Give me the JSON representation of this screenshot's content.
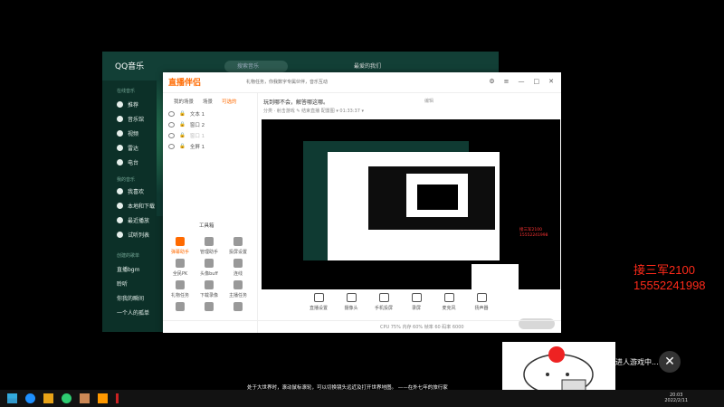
{
  "qq": {
    "logo": "QQ音乐",
    "search_placeholder": "搜索音乐",
    "username": "最爱的我们",
    "sections": {
      "online": "在线音乐",
      "mine": "我的音乐",
      "created": "创建的歌单"
    },
    "nav": [
      "推荐",
      "音乐馆",
      "视频",
      "雷达",
      "电台"
    ],
    "mine_items": [
      "我喜欢",
      "本地和下载",
      "最近播放",
      "试听列表"
    ],
    "playlists": [
      "直播bgm",
      "聆听",
      "你我的瞬间",
      "一个人的孤单"
    ]
  },
  "obs": {
    "logo": "直播伴侣",
    "slogan": "礼物任务，你我数字专属伙伴，音乐互动",
    "scene_tabs": [
      "我的场景",
      "场景",
      "可选的"
    ],
    "sources": [
      "文本 1",
      "窗口 2",
      "窗口 1",
      "全屏 1"
    ],
    "tools_title": "工具箱",
    "tools": [
      "弹幕助手",
      "管理助手",
      "投屏设置",
      "全民PK",
      "头像buff",
      "连线",
      "礼物任务",
      "下载录像",
      "主播任务",
      "",
      "",
      ""
    ],
    "stream_title": "玩到哪不会，解答哪这哪。",
    "edit_label": "编辑",
    "meta": "分类 · 射击游戏  ✎   结束直播   配置图 ▾   01:33:37   ▾",
    "controls": [
      "直播设置",
      "摄像头",
      "手机投屏",
      "录屏",
      "麦克风",
      "扬声器"
    ],
    "status_text": "CPU 75%   内存 60%   帧率 60   码率 6000"
  },
  "overlay": {
    "line1": "接三军2100",
    "line2": "15552241998"
  },
  "danmaku": "进人游戏中...",
  "subtitle": "处于大世界时，滚动鼠标滚轮，可以切换镜头远近及打开世界地图。 ——在外七年的旅行家",
  "clock": {
    "time": "20:03",
    "date": "2022/2/11"
  }
}
